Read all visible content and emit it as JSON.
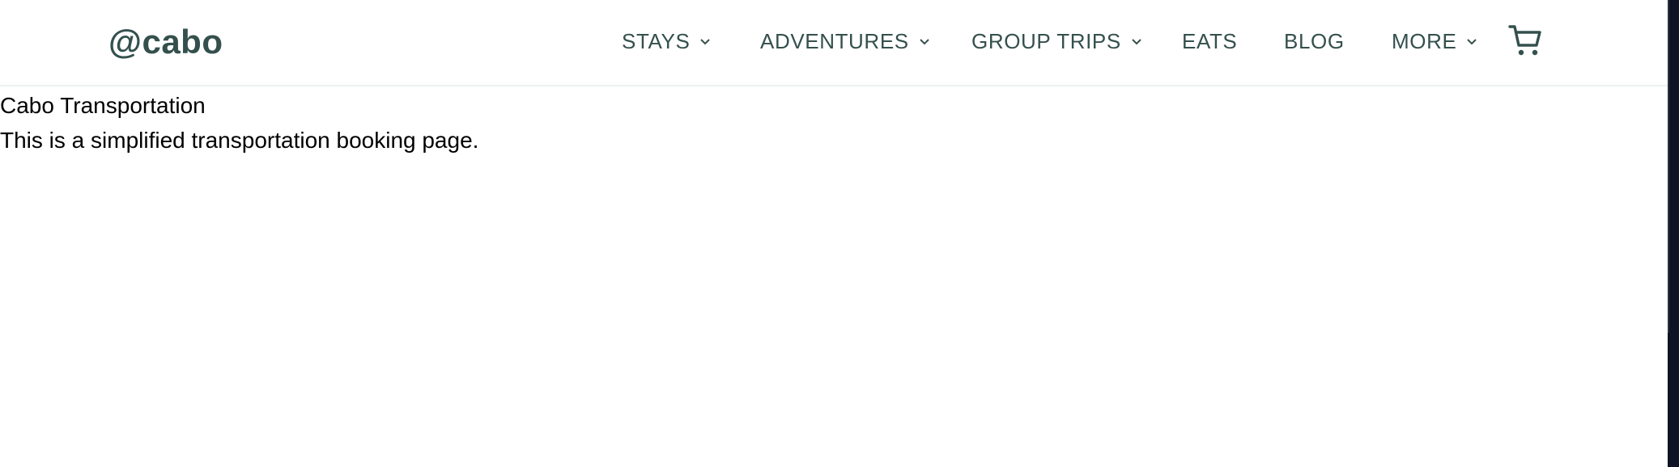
{
  "header": {
    "logo": "@cabo",
    "nav": {
      "stays": "STAYS",
      "adventures": "ADVENTURES",
      "group_trips": "GROUP TRIPS",
      "eats": "EATS",
      "blog": "BLOG",
      "more": "MORE"
    },
    "icons": {
      "dropdown": "chevron-down-icon",
      "cart": "shopping-cart-icon"
    }
  },
  "main": {
    "title": "Cabo Transportation",
    "description": "This is a simplified transportation booking page."
  },
  "colors": {
    "brand": "#34504d",
    "background": "#ffffff",
    "text": "#000000",
    "divider": "#eef0f0",
    "side_strip": "#0f1424"
  }
}
